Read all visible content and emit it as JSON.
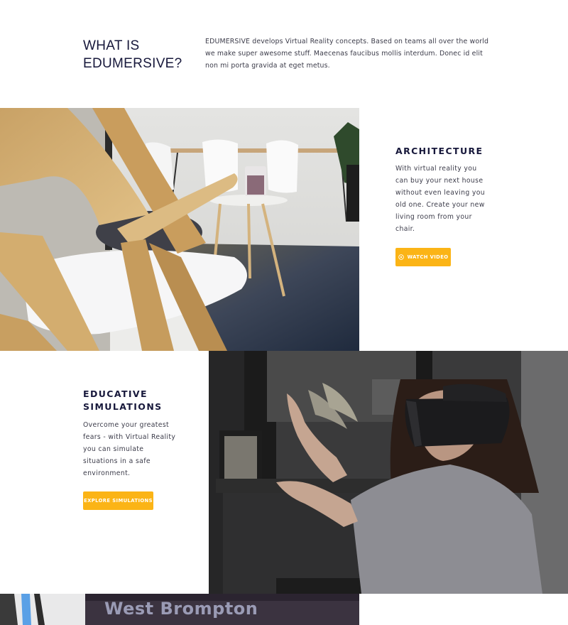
{
  "intro": {
    "title_line1": "WHAT IS",
    "title_line2": "EDUMERSIVE?",
    "text": "EDUMERSIVE develops Virtual Reality concepts. Based on teams all over the world we make super awesome stuff. Maecenas faucibus mollis interdum. Donec id elit non mi porta gravida at eget metus."
  },
  "architecture": {
    "title": "ARCHITECTURE",
    "text": "With virtual reality you can buy your next house without even leaving you old one. Create your new living room from your chair.",
    "button_label": "WATCH VIDEO",
    "button_icon": "play-circle-icon"
  },
  "simulations": {
    "title_line1": "EDUCATIVE",
    "title_line2": "SIMULATIONS",
    "text": "Overcome your greatest fears - with Virtual Reality you can simulate situations in a safe environment.",
    "button_label": "EXPLORE SIMULATIONS"
  },
  "teaser": {
    "sign_text": "West Brompton"
  },
  "colors": {
    "accent": "#fbb416",
    "heading": "#17183b",
    "body_text": "#3c3c4a",
    "background": "#ffffff"
  }
}
